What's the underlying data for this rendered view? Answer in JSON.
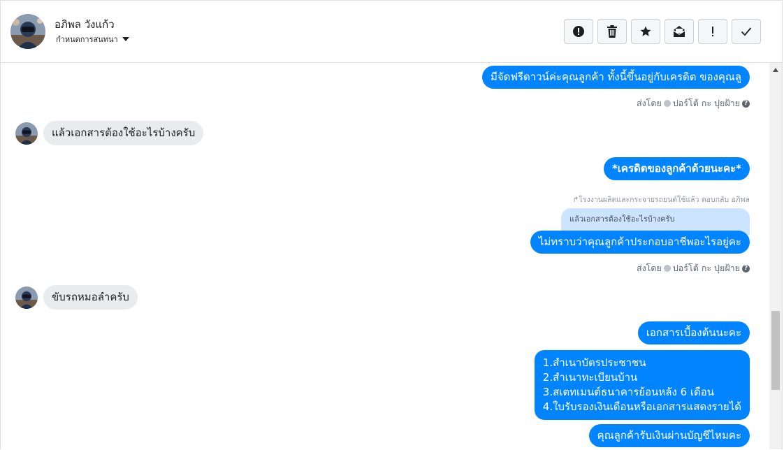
{
  "header": {
    "contact_name": "อภิพล วังแก้ว",
    "conversation_setting": "กำหนดการสนทนา",
    "actions": [
      {
        "name": "report-icon"
      },
      {
        "name": "trash-icon"
      },
      {
        "name": "star-icon"
      },
      {
        "name": "mark-unread-icon"
      },
      {
        "name": "important-icon"
      },
      {
        "name": "done-icon"
      }
    ]
  },
  "messages": {
    "m1": "มีจัดฟรีดาวน์ค่ะคุณลูกค้า ทั้งนี้ขึ้นอยู่กับเครดิต ของคุณลู",
    "m1_sent_prefix": "ส่งโดย",
    "m1_sent_name": "ปอร์โต้ กะ ปุยฝ้าย",
    "m2": "แล้วเอกสารต้องใช้อะไรบ้างครับ",
    "m3": "*เครดิตของลูกค้าด้วยนะคะ*",
    "m4_reply_meta": "โรงงานผลิตและกระจายรถยนต์ใช้แล้ว ตอบกลับ อภิพล",
    "m4_quoted": "แล้วเอกสารต้องใช้อะไรบ้างครับ",
    "m4": "ไม่ทราบว่าคุณลูกค้าประกอบอาชีพอะไรอยู่คะ",
    "m4_sent_prefix": "ส่งโดย",
    "m4_sent_name": "ปอร์โต้ กะ ปุยฝ้าย",
    "m5": "ขับรถหมอลำครับ",
    "m6": "เอกสารเบื้องต้นนะคะ",
    "m7": "1.สำเนาบัตรประชาชน\n2.สำเนาทะเบียนบ้าน\n3.สเตทเมนต์ธนาคารย้อนหลัง 6 เดือน\n4.ใบรับรองเงินเดือนหรือเอกสารแสดงรายได้",
    "m8": "คุณลูกค้ารับเงินผ่านบัญชีไหมคะ"
  },
  "colors": {
    "outgoing_bubble": "#0084ff",
    "incoming_bubble": "#e9ebee",
    "quoted_bubble": "#cce4ff"
  }
}
